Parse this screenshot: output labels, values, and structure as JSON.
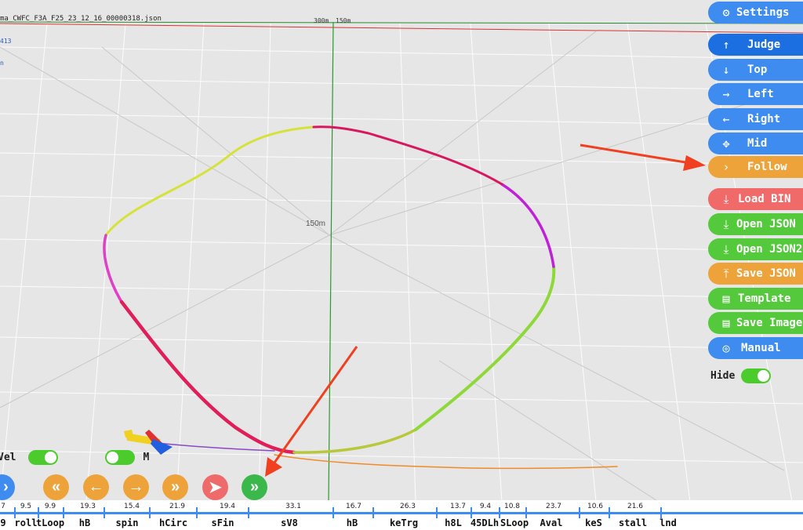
{
  "header": {
    "filename": "ma_CWFC_F3A_F25_23_12_16_00000318.json",
    "side_value": "413",
    "side_mark": "n",
    "dist_labels": [
      "300m",
      "150m"
    ],
    "center_label": "150m"
  },
  "panel": {
    "settings": "Settings",
    "judge": "Judge",
    "top": "Top",
    "left": "Left",
    "right": "Right",
    "mid": "Mid",
    "follow": "Follow",
    "load_bin": "Load BIN",
    "open_json": "Open JSON",
    "open_json2": "Open JSON2",
    "save_json": "Save JSON",
    "template": "Template",
    "save_image": "Save Image",
    "manual": "Manual",
    "hide": "Hide"
  },
  "toggles": {
    "vel": "Vel",
    "m": "M"
  },
  "colors": {
    "blue": "#3f8cf0",
    "orange": "#eea33a",
    "red": "#f06a6a",
    "green": "#55c93c",
    "annotation_arrow": "#f04020"
  },
  "timeline": {
    "segments": [
      {
        "score": "7",
        "name": "9"
      },
      {
        "score": "9.5",
        "name": "roll"
      },
      {
        "score": "9.9",
        "name": "tLoop"
      },
      {
        "score": "19.3",
        "name": "hB"
      },
      {
        "score": "15.4",
        "name": "spin"
      },
      {
        "score": "21.9",
        "name": "hCirc"
      },
      {
        "score": "19.4",
        "name": "sFin"
      },
      {
        "score": "33.1",
        "name": "sV8"
      },
      {
        "score": "16.7",
        "name": "hB"
      },
      {
        "score": "26.3",
        "name": "keTrg"
      },
      {
        "score": "13.7",
        "name": "h8L"
      },
      {
        "score": "9.4",
        "name": "45DLh"
      },
      {
        "score": "10.8",
        "name": "SLoop"
      },
      {
        "score": "23.7",
        "name": "Aval"
      },
      {
        "score": "10.6",
        "name": "keS"
      },
      {
        "score": "21.6",
        "name": "stall"
      },
      {
        "score": "",
        "name": "lnd"
      }
    ]
  }
}
